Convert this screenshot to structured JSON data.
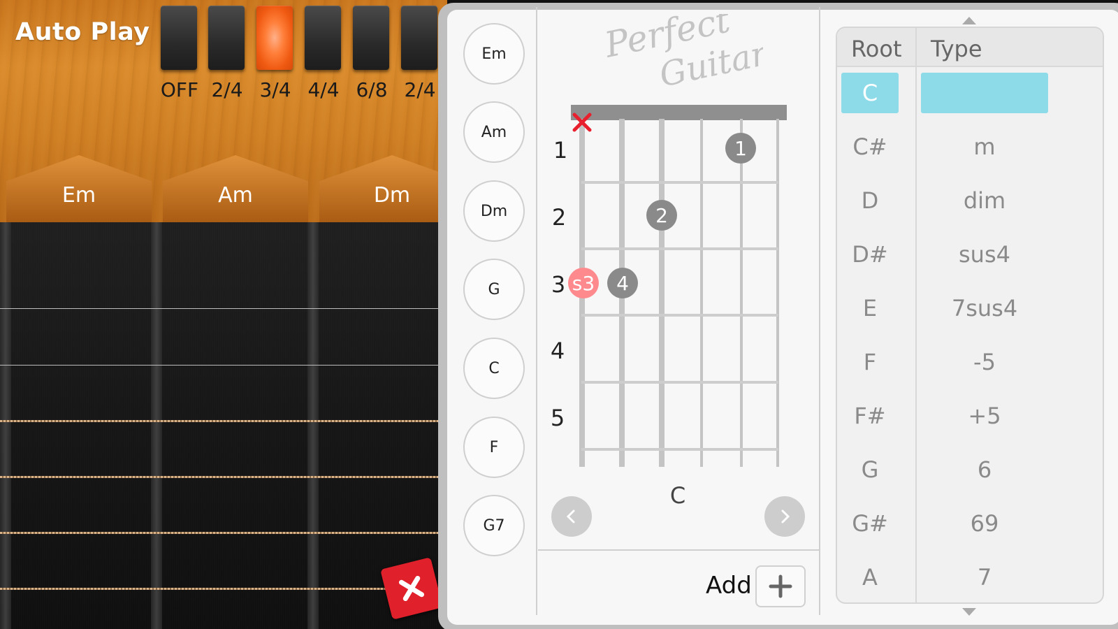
{
  "autoplay": {
    "title": "Auto Play",
    "beats": [
      {
        "label": "OFF",
        "active": false
      },
      {
        "label": "2/4",
        "active": false
      },
      {
        "label": "3/4",
        "active": true
      },
      {
        "label": "4/4",
        "active": false
      },
      {
        "label": "6/8",
        "active": false
      },
      {
        "label": "2/4",
        "active": false
      }
    ]
  },
  "chord_tabs": [
    "Em",
    "Am",
    "Dm"
  ],
  "saved_chords": [
    "Em",
    "Am",
    "Dm",
    "G",
    "C",
    "F",
    "G7"
  ],
  "diagram": {
    "logo_line1": "Perfect",
    "logo_line2": "Guitar",
    "fret_numbers": [
      "1",
      "2",
      "3",
      "4",
      "5"
    ],
    "fingers": {
      "f1": "1",
      "f2": "2",
      "f3": "s3",
      "f4": "4"
    },
    "muted_icon": "x-mark-icon",
    "chord_name": "C",
    "prev_icon": "chevron-left-icon",
    "next_icon": "chevron-right-icon"
  },
  "add": {
    "label": "Add",
    "icon": "plus-icon"
  },
  "picker": {
    "root_header": "Root",
    "type_header": "Type",
    "roots": [
      "C",
      "C#",
      "D",
      "D#",
      "E",
      "F",
      "F#",
      "G",
      "G#",
      "A"
    ],
    "types": [
      "",
      "m",
      "dim",
      "sus4",
      "7sus4",
      "-5",
      "+5",
      "6",
      "69",
      "7"
    ],
    "selected_root": "C",
    "selected_type": ""
  },
  "colors": {
    "accent_selection": "#8ddbe8",
    "active_beat": "#f05a12",
    "sus_finger": "#ff8a8e",
    "muted_x": "#e8202e",
    "close_button": "#e0202a"
  },
  "close_icon": "close-icon"
}
